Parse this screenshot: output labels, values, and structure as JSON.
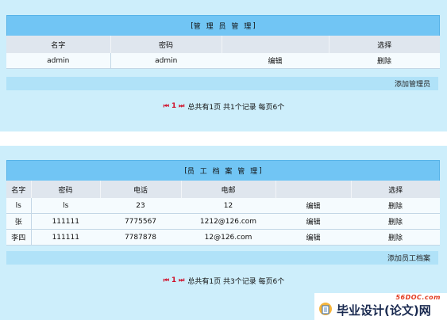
{
  "admin_section": {
    "title": "管 理 员 管 理",
    "columns": [
      "名字",
      "密码",
      "选择"
    ],
    "rows": [
      {
        "name": "admin",
        "password": "admin",
        "edit": "编辑",
        "delete": "删除"
      }
    ],
    "add_button": "添加管理员",
    "pager": {
      "current": "1",
      "summary": "总共有1页  共1个记录  每页6个"
    }
  },
  "staff_section": {
    "title": "员 工 档 案 管 理",
    "columns": [
      "名字",
      "密码",
      "电话",
      "电邮",
      "选择"
    ],
    "rows": [
      {
        "name": "ls",
        "password": "ls",
        "phone": "23",
        "email": "12",
        "edit": "编辑",
        "delete": "删除"
      },
      {
        "name": "张",
        "password": "111111",
        "phone": "7775567",
        "email": "1212@126.com",
        "edit": "编辑",
        "delete": "删除"
      },
      {
        "name": "李四",
        "password": "111111",
        "phone": "7787878",
        "email": "12@126.com",
        "edit": "编辑",
        "delete": "删除"
      }
    ],
    "add_button": "添加员工档案",
    "pager": {
      "current": "1",
      "summary": "总共有1页  共3个记录  每页6个"
    }
  },
  "watermark": {
    "site": "56DOC.com",
    "text": "毕业设计(论文)网"
  },
  "colors": {
    "panel_bg": "#cdeefb",
    "title_bar": "#71c5f4",
    "header_row": "#dfe6ee",
    "action_bar": "#b0e2f8",
    "pager_accent": "#d0102a"
  },
  "icons": {
    "pager_first": "first-page-icon",
    "pager_last": "last-page-icon"
  }
}
